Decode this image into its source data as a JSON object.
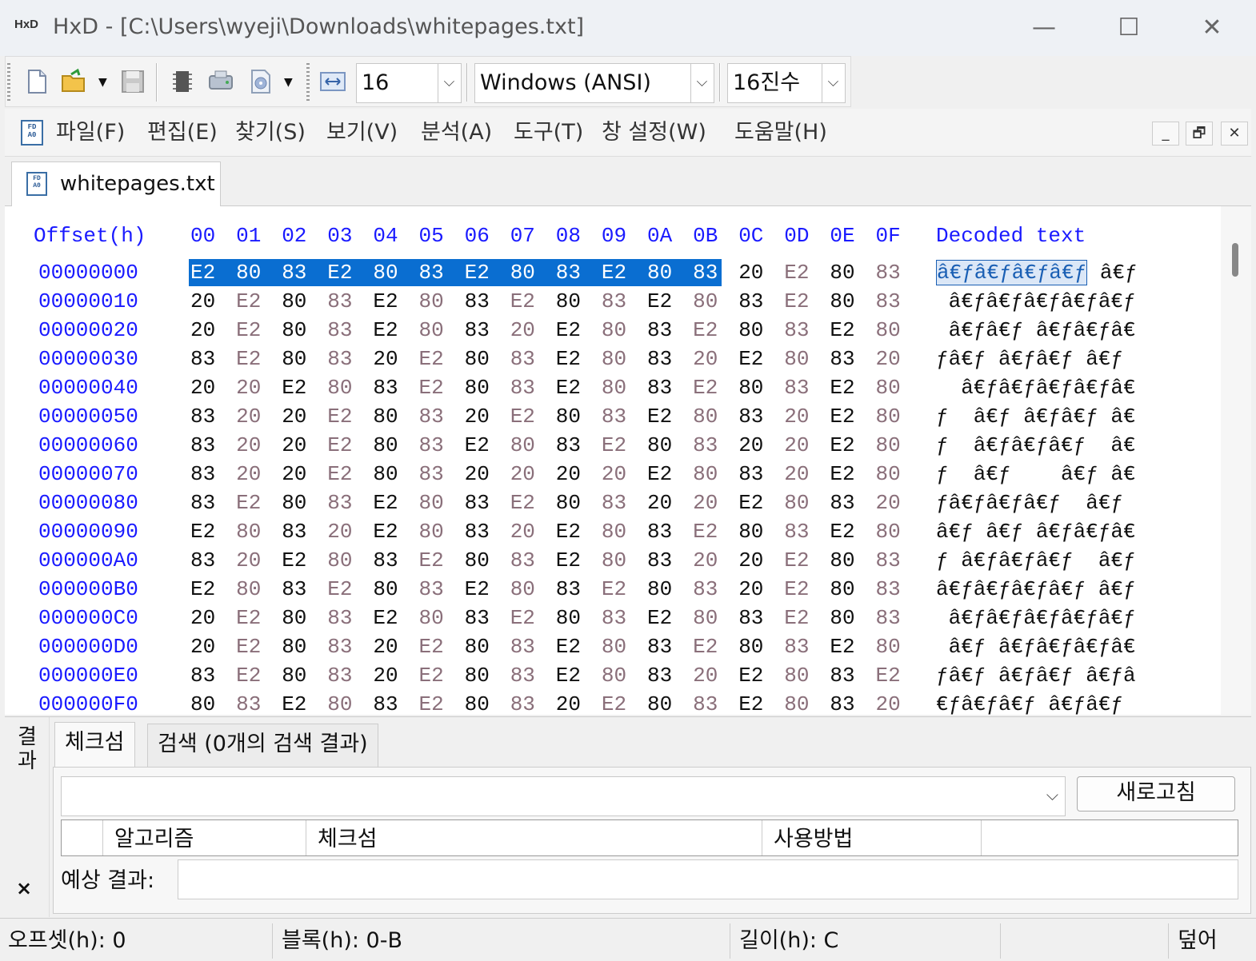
{
  "window": {
    "icon_text": "HxD",
    "title": "HxD - [C:\\Users\\wyeji\\Downloads\\whitepages.txt]",
    "minimize": "—",
    "maximize": "☐",
    "close": "✕"
  },
  "toolbar": {
    "bytes_per_row": "16",
    "encoding": "Windows (ANSI)",
    "offset_base": "16진수",
    "dropdown_arrow": "⌵"
  },
  "menu": {
    "icon_text": "FD A0",
    "items": [
      "파일(F)",
      "편집(E)",
      "찾기(S)",
      "보기(V)",
      "분석(A)",
      "도구(T)",
      "창 설정(W)",
      "도움말(H)"
    ],
    "mdi_minimize": "_",
    "mdi_restore": "🗗",
    "mdi_close": "✕"
  },
  "file_tab": {
    "icon_text": "FD A0",
    "label": "whitepages.txt"
  },
  "hex": {
    "offset_header": "Offset(h)",
    "columns": [
      "00",
      "01",
      "02",
      "03",
      "04",
      "05",
      "06",
      "07",
      "08",
      "09",
      "0A",
      "0B",
      "0C",
      "0D",
      "0E",
      "0F"
    ],
    "decoded_header": "Decoded text",
    "selection_length": 12,
    "rows": [
      {
        "offset": "00000000",
        "bytes": [
          "E2",
          "80",
          "83",
          "E2",
          "80",
          "83",
          "E2",
          "80",
          "83",
          "E2",
          "80",
          "83",
          "20",
          "E2",
          "80",
          "83"
        ],
        "decoded": "â€ƒâ€ƒâ€ƒâ€ƒ â€ƒ"
      },
      {
        "offset": "00000010",
        "bytes": [
          "20",
          "E2",
          "80",
          "83",
          "E2",
          "80",
          "83",
          "E2",
          "80",
          "83",
          "E2",
          "80",
          "83",
          "E2",
          "80",
          "83"
        ],
        "decoded": " â€ƒâ€ƒâ€ƒâ€ƒâ€ƒ"
      },
      {
        "offset": "00000020",
        "bytes": [
          "20",
          "E2",
          "80",
          "83",
          "E2",
          "80",
          "83",
          "20",
          "E2",
          "80",
          "83",
          "E2",
          "80",
          "83",
          "E2",
          "80"
        ],
        "decoded": " â€ƒâ€ƒ â€ƒâ€ƒâ€"
      },
      {
        "offset": "00000030",
        "bytes": [
          "83",
          "E2",
          "80",
          "83",
          "20",
          "E2",
          "80",
          "83",
          "E2",
          "80",
          "83",
          "20",
          "E2",
          "80",
          "83",
          "20"
        ],
        "decoded": "ƒâ€ƒ â€ƒâ€ƒ â€ƒ "
      },
      {
        "offset": "00000040",
        "bytes": [
          "20",
          "20",
          "E2",
          "80",
          "83",
          "E2",
          "80",
          "83",
          "E2",
          "80",
          "83",
          "E2",
          "80",
          "83",
          "E2",
          "80"
        ],
        "decoded": "  â€ƒâ€ƒâ€ƒâ€ƒâ€"
      },
      {
        "offset": "00000050",
        "bytes": [
          "83",
          "20",
          "20",
          "E2",
          "80",
          "83",
          "20",
          "E2",
          "80",
          "83",
          "E2",
          "80",
          "83",
          "20",
          "E2",
          "80"
        ],
        "decoded": "ƒ  â€ƒ â€ƒâ€ƒ â€"
      },
      {
        "offset": "00000060",
        "bytes": [
          "83",
          "20",
          "20",
          "E2",
          "80",
          "83",
          "E2",
          "80",
          "83",
          "E2",
          "80",
          "83",
          "20",
          "20",
          "E2",
          "80"
        ],
        "decoded": "ƒ  â€ƒâ€ƒâ€ƒ  â€"
      },
      {
        "offset": "00000070",
        "bytes": [
          "83",
          "20",
          "20",
          "E2",
          "80",
          "83",
          "20",
          "20",
          "20",
          "20",
          "E2",
          "80",
          "83",
          "20",
          "E2",
          "80"
        ],
        "decoded": "ƒ  â€ƒ    â€ƒ â€"
      },
      {
        "offset": "00000080",
        "bytes": [
          "83",
          "E2",
          "80",
          "83",
          "E2",
          "80",
          "83",
          "E2",
          "80",
          "83",
          "20",
          "20",
          "E2",
          "80",
          "83",
          "20"
        ],
        "decoded": "ƒâ€ƒâ€ƒâ€ƒ  â€ƒ "
      },
      {
        "offset": "00000090",
        "bytes": [
          "E2",
          "80",
          "83",
          "20",
          "E2",
          "80",
          "83",
          "20",
          "E2",
          "80",
          "83",
          "E2",
          "80",
          "83",
          "E2",
          "80"
        ],
        "decoded": "â€ƒ â€ƒ â€ƒâ€ƒâ€"
      },
      {
        "offset": "000000A0",
        "bytes": [
          "83",
          "20",
          "E2",
          "80",
          "83",
          "E2",
          "80",
          "83",
          "E2",
          "80",
          "83",
          "20",
          "20",
          "E2",
          "80",
          "83"
        ],
        "decoded": "ƒ â€ƒâ€ƒâ€ƒ  â€ƒ"
      },
      {
        "offset": "000000B0",
        "bytes": [
          "E2",
          "80",
          "83",
          "E2",
          "80",
          "83",
          "E2",
          "80",
          "83",
          "E2",
          "80",
          "83",
          "20",
          "E2",
          "80",
          "83"
        ],
        "decoded": "â€ƒâ€ƒâ€ƒâ€ƒ â€ƒ"
      },
      {
        "offset": "000000C0",
        "bytes": [
          "20",
          "E2",
          "80",
          "83",
          "E2",
          "80",
          "83",
          "E2",
          "80",
          "83",
          "E2",
          "80",
          "83",
          "E2",
          "80",
          "83"
        ],
        "decoded": " â€ƒâ€ƒâ€ƒâ€ƒâ€ƒ"
      },
      {
        "offset": "000000D0",
        "bytes": [
          "20",
          "E2",
          "80",
          "83",
          "20",
          "E2",
          "80",
          "83",
          "E2",
          "80",
          "83",
          "E2",
          "80",
          "83",
          "E2",
          "80"
        ],
        "decoded": " â€ƒ â€ƒâ€ƒâ€ƒâ€"
      },
      {
        "offset": "000000E0",
        "bytes": [
          "83",
          "E2",
          "80",
          "83",
          "20",
          "E2",
          "80",
          "83",
          "E2",
          "80",
          "83",
          "20",
          "E2",
          "80",
          "83",
          "E2"
        ],
        "decoded": "ƒâ€ƒ â€ƒâ€ƒ â€ƒâ"
      },
      {
        "offset": "000000F0",
        "bytes": [
          "80",
          "83",
          "E2",
          "80",
          "83",
          "E2",
          "80",
          "83",
          "20",
          "E2",
          "80",
          "83",
          "E2",
          "80",
          "83",
          "20"
        ],
        "decoded": "€ƒâ€ƒâ€ƒ â€ƒâ€ƒ "
      }
    ]
  },
  "results": {
    "title": "결과",
    "close": "×",
    "tabs": [
      "체크섬",
      "검색 (0개의 검색 결과)"
    ],
    "refresh_label": "새로고침",
    "combo_arrow": "⌵",
    "columns": [
      "",
      "알고리즘",
      "체크섬",
      "사용방법",
      ""
    ],
    "expected_label": "예상 결과:"
  },
  "status": {
    "offset": "오프셋(h): 0",
    "block": "블록(h): 0-B",
    "length": "길이(h): C",
    "mode": "덮어"
  }
}
